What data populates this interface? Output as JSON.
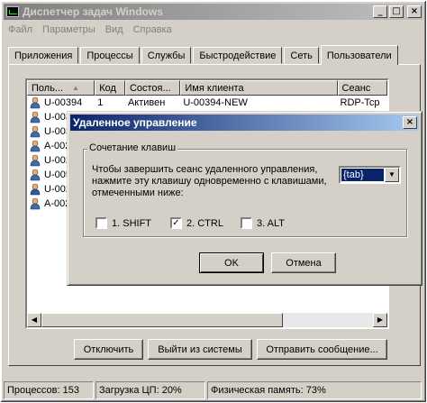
{
  "window": {
    "title": "Диспетчер задач Windows",
    "min": "_",
    "max": "□",
    "close": "×"
  },
  "menu": [
    "Файл",
    "Параметры",
    "Вид",
    "Справка"
  ],
  "tabs": [
    "Приложения",
    "Процессы",
    "Службы",
    "Быстродействие",
    "Сеть",
    "Пользователи"
  ],
  "table": {
    "headers": [
      "Поль...",
      "Код",
      "Состоя...",
      "Имя клиента",
      "Сеанс"
    ],
    "rows": [
      [
        "U-00394",
        "1",
        "Активен",
        "U-00394-NEW",
        "RDP-Tcp"
      ],
      [
        "U-003",
        "",
        "",
        "",
        ""
      ],
      [
        "U-003",
        "",
        "",
        "",
        ""
      ],
      [
        "A-002",
        "",
        "",
        "",
        ""
      ],
      [
        "U-002",
        "",
        "",
        "",
        ""
      ],
      [
        "U-005",
        "",
        "",
        "",
        ""
      ],
      [
        "U-002",
        "",
        "",
        "",
        ""
      ],
      [
        "A-002",
        "",
        "",
        "",
        ""
      ]
    ]
  },
  "buttons": {
    "disconnect": "Отключить",
    "logoff": "Выйти из системы",
    "send": "Отправить сообщение..."
  },
  "status": {
    "processes": "Процессов: 153",
    "cpu": "Загрузка ЦП: 20%",
    "memory": "Физическая память: 73%"
  },
  "dialog": {
    "title": "Удаленное управление",
    "group": "Сочетание клавиш",
    "text": "Чтобы завершить сеанс удаленного управления, нажмите эту клавишу одновременно с клавишами, отмеченными ниже:",
    "combo": "{tab}",
    "shift": "1. SHIFT",
    "ctrl": "2. CTRL",
    "alt": "3. ALT",
    "ok": "OK",
    "cancel": "Отмена",
    "check": "✓"
  }
}
